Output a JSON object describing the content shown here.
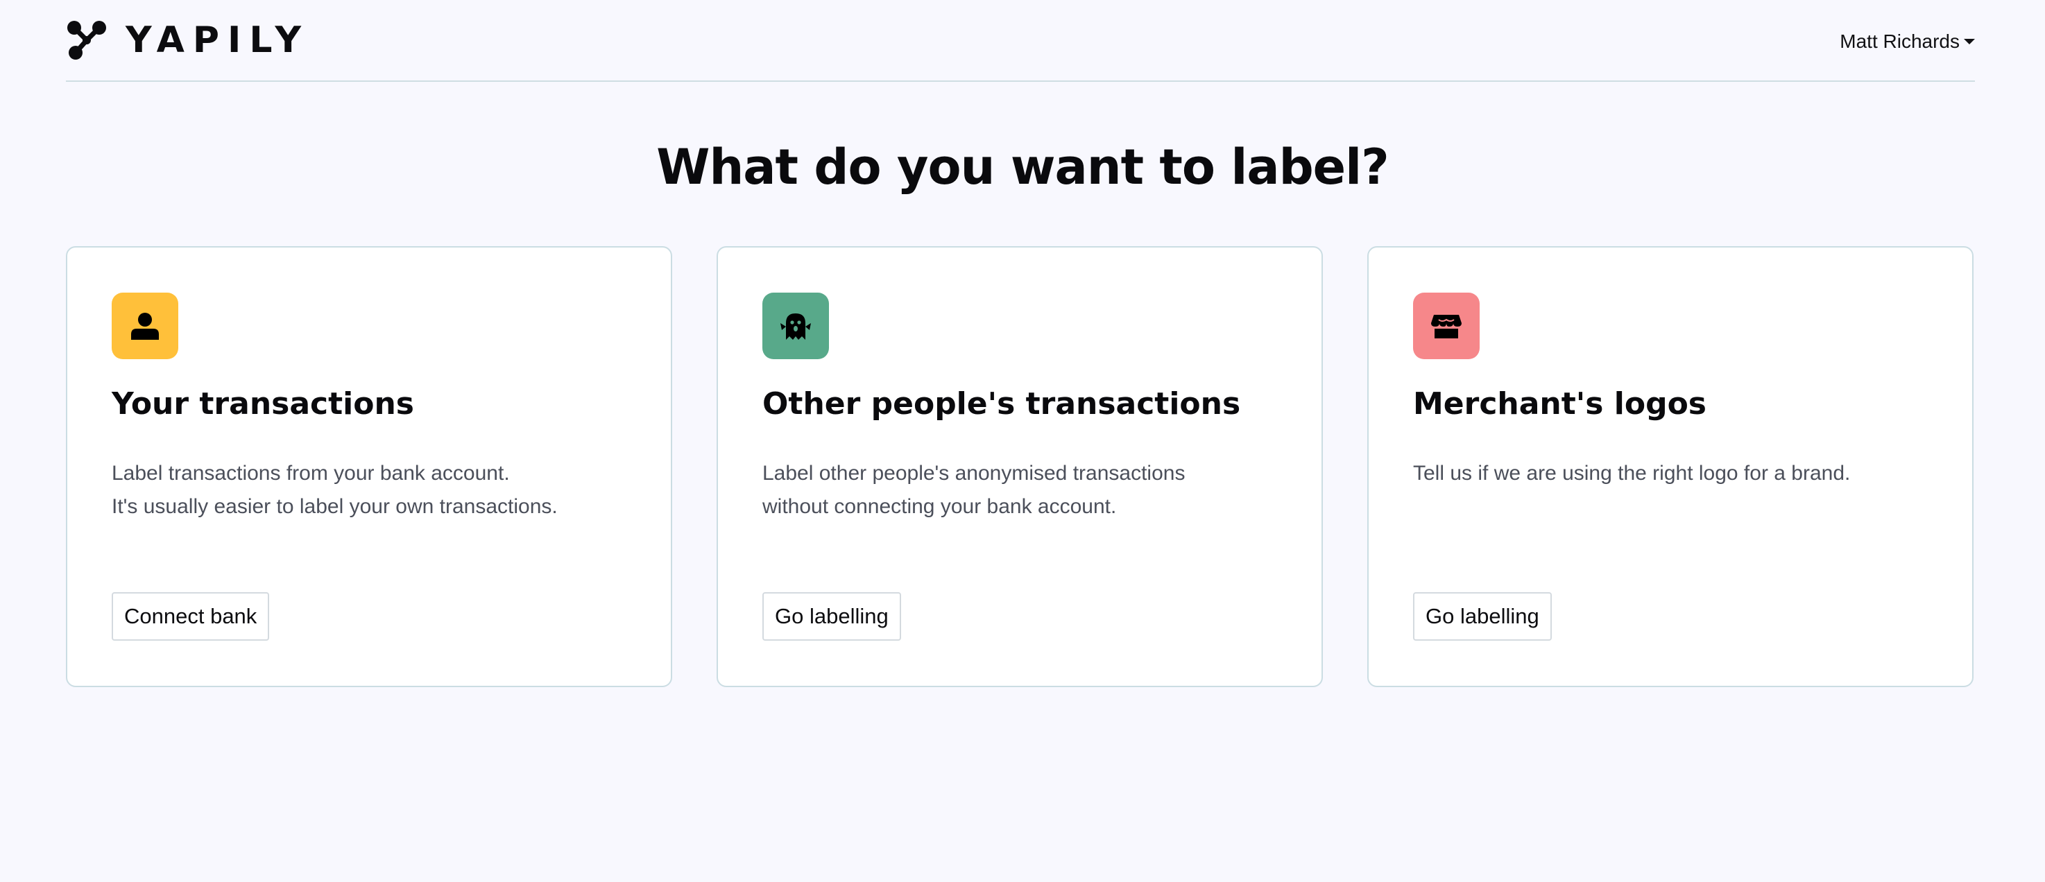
{
  "app": {
    "brand": "YAPILY",
    "colors": {
      "background": "#f8f8fe",
      "divider": "#cfdee3",
      "card_border": "#cbdde3",
      "text_primary": "#0c0c0f",
      "text_secondary": "#4b4f5a"
    }
  },
  "header": {
    "logo_icon": "yapily-logo-icon",
    "user_name": "Matt Richards",
    "user_menu_icon": "caret-down-icon"
  },
  "main": {
    "title": "What do you want to label?",
    "cards": [
      {
        "icon": "person-icon",
        "icon_bg": "#ffc03a",
        "title": "Your transactions",
        "description_lines": [
          "Label transactions from your bank account.",
          "It's usually easier to label your own transactions."
        ],
        "button_label": "Connect bank"
      },
      {
        "icon": "ghost-icon",
        "icon_bg": "#58a98a",
        "title": "Other people's transactions",
        "description_lines": [
          "Label other people's anonymised transactions",
          "without connecting your bank account."
        ],
        "button_label": "Go labelling"
      },
      {
        "icon": "store-icon",
        "icon_bg": "#f6878a",
        "title": "Merchant's logos",
        "description_lines": [
          "Tell us if we are using the right logo for a brand."
        ],
        "button_label": "Go labelling"
      }
    ]
  }
}
